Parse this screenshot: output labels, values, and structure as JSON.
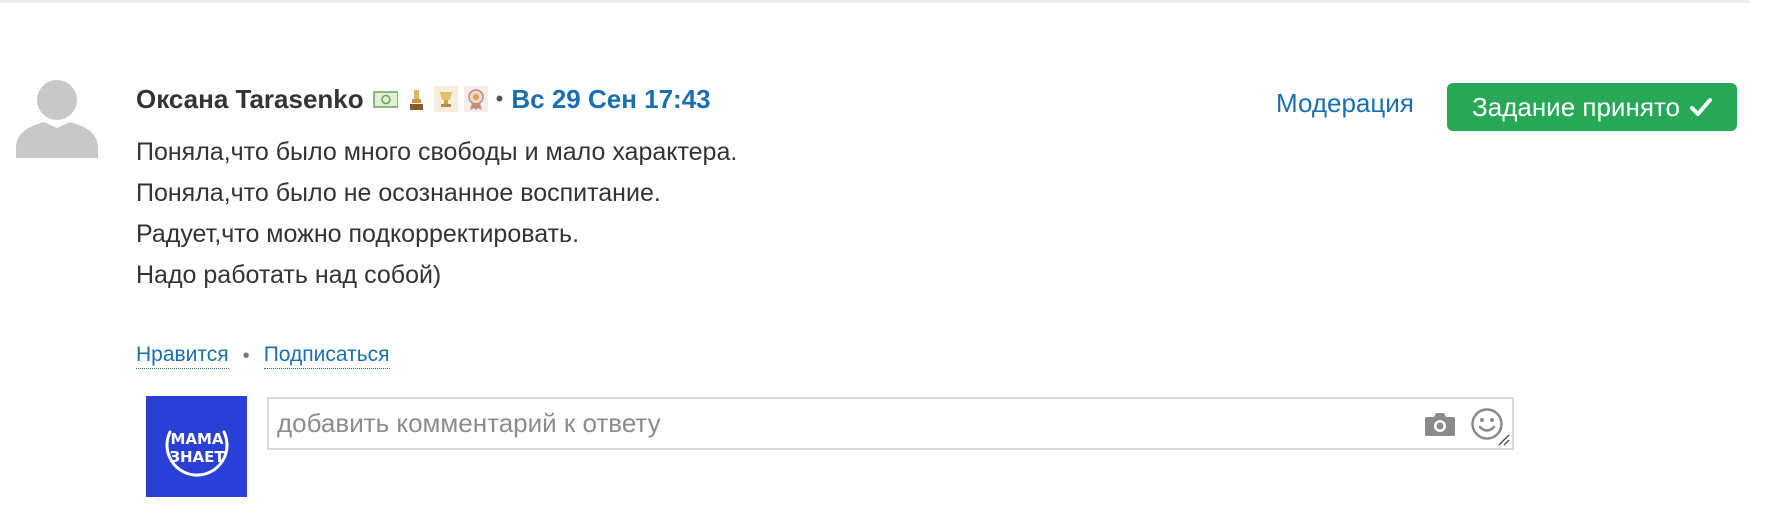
{
  "comment": {
    "author_name": "Оксана Tarasenko",
    "separator": "•",
    "date": "Вс 29 Сен 17:43",
    "body_lines": [
      "Поняла,что было много свободы и мало характера.",
      "Поняла,что было не осознанное воспитание.",
      "Радует,что можно подкорректировать.",
      "Надо работать над собой)"
    ],
    "badges": [
      "money-badge-icon",
      "trophy-badge-icon",
      "cup-badge-icon",
      "medal-badge-icon"
    ]
  },
  "header_actions": {
    "moderation_label": "Модерация",
    "accepted_label": "Задание принято",
    "accepted_icon": "check-icon",
    "accepted_color": "#27a856"
  },
  "actions": {
    "like_label": "Нравится",
    "separator": "•",
    "subscribe_label": "Подписаться"
  },
  "reply": {
    "logo_text_line1": "МАМА",
    "logo_text_line2": "ЗНАЕТ",
    "logo_color": "#2a3fd6",
    "placeholder": "добавить комментарий к ответу",
    "camera_icon": "camera-icon",
    "emoji_icon": "smiley-icon"
  },
  "colors": {
    "link": "#1a6fb0",
    "text": "#333333"
  }
}
